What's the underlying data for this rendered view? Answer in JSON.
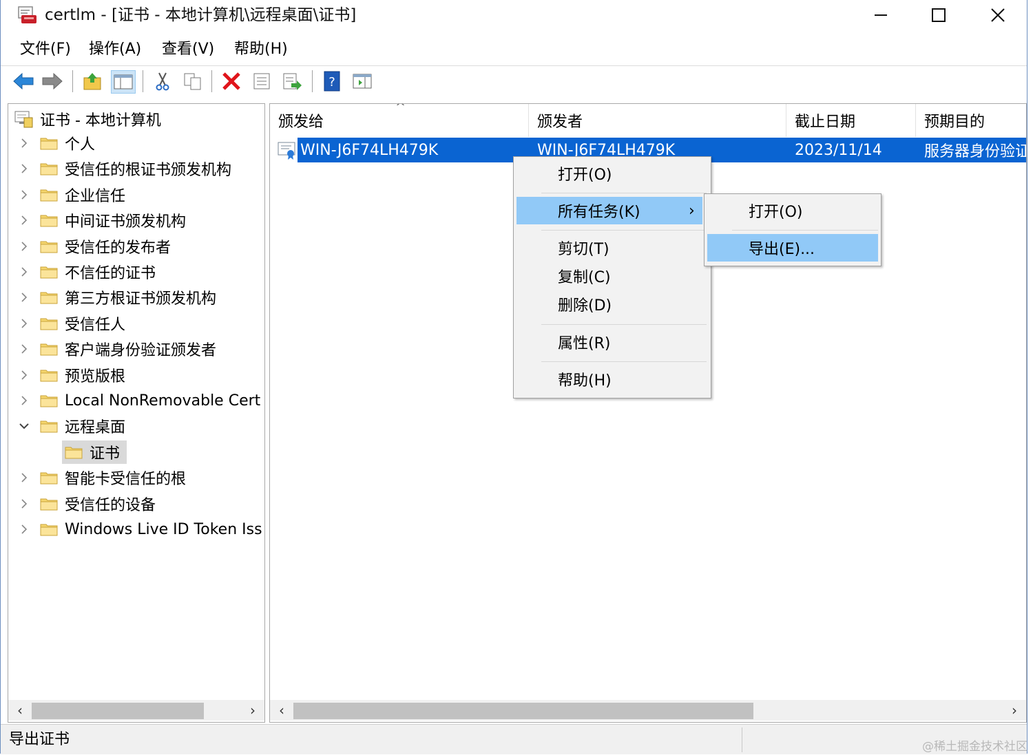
{
  "window": {
    "title": "certlm - [证书 - 本地计算机\\远程桌面\\证书]",
    "minimize_glyph": "—",
    "maximize_glyph": "☐",
    "close_glyph": "✕"
  },
  "menubar": {
    "items": [
      "文件(F)",
      "操作(A)",
      "查看(V)",
      "帮助(H)"
    ]
  },
  "toolbar": {
    "icons": [
      "back-arrow-icon",
      "forward-arrow-icon",
      "up-folder-icon",
      "show-hide-tree-icon",
      "cut-icon",
      "copy-icon",
      "delete-icon",
      "properties-icon",
      "export-list-icon",
      "help-icon",
      "mmc-view-icon"
    ]
  },
  "tree": {
    "root_label": "证书 - 本地计算机",
    "items": [
      {
        "label": "个人",
        "expanded": false
      },
      {
        "label": "受信任的根证书颁发机构",
        "expanded": false
      },
      {
        "label": "企业信任",
        "expanded": false
      },
      {
        "label": "中间证书颁发机构",
        "expanded": false
      },
      {
        "label": "受信任的发布者",
        "expanded": false
      },
      {
        "label": "不信任的证书",
        "expanded": false
      },
      {
        "label": "第三方根证书颁发机构",
        "expanded": false
      },
      {
        "label": "受信任人",
        "expanded": false
      },
      {
        "label": "客户端身份验证颁发者",
        "expanded": false
      },
      {
        "label": "预览版根",
        "expanded": false
      },
      {
        "label": "Local NonRemovable Cert",
        "expanded": false
      },
      {
        "label": "远程桌面",
        "expanded": true
      },
      {
        "label": "证书",
        "child": true,
        "selected": true
      },
      {
        "label": "智能卡受信任的根",
        "expanded": false
      },
      {
        "label": "受信任的设备",
        "expanded": false
      },
      {
        "label": "Windows Live ID Token Iss",
        "expanded": false
      }
    ]
  },
  "list": {
    "columns": [
      "颁发给",
      "颁发者",
      "截止日期",
      "预期目的"
    ],
    "sort_glyph": "^",
    "rows": [
      {
        "issued_to": "WIN-J6F74LH479K",
        "issued_by": "WIN-J6F74LH479K",
        "expiry": "2023/11/14",
        "purpose": "服务器身份验证"
      }
    ]
  },
  "context_menu": {
    "items": [
      "打开(O)",
      "所有任务(K)",
      "剪切(T)",
      "复制(C)",
      "删除(D)",
      "属性(R)",
      "帮助(H)"
    ],
    "highlighted": "所有任务(K)",
    "submenu_arrow": "›"
  },
  "submenu": {
    "items": [
      "打开(O)",
      "导出(E)..."
    ],
    "highlighted": "导出(E)..."
  },
  "statusbar": {
    "text": "导出证书"
  },
  "watermark": "@稀土掘金技术社区",
  "colors": {
    "selection": "#0a64d2",
    "menu_highlight": "#91c9f7",
    "folder": "#f5d66e"
  }
}
